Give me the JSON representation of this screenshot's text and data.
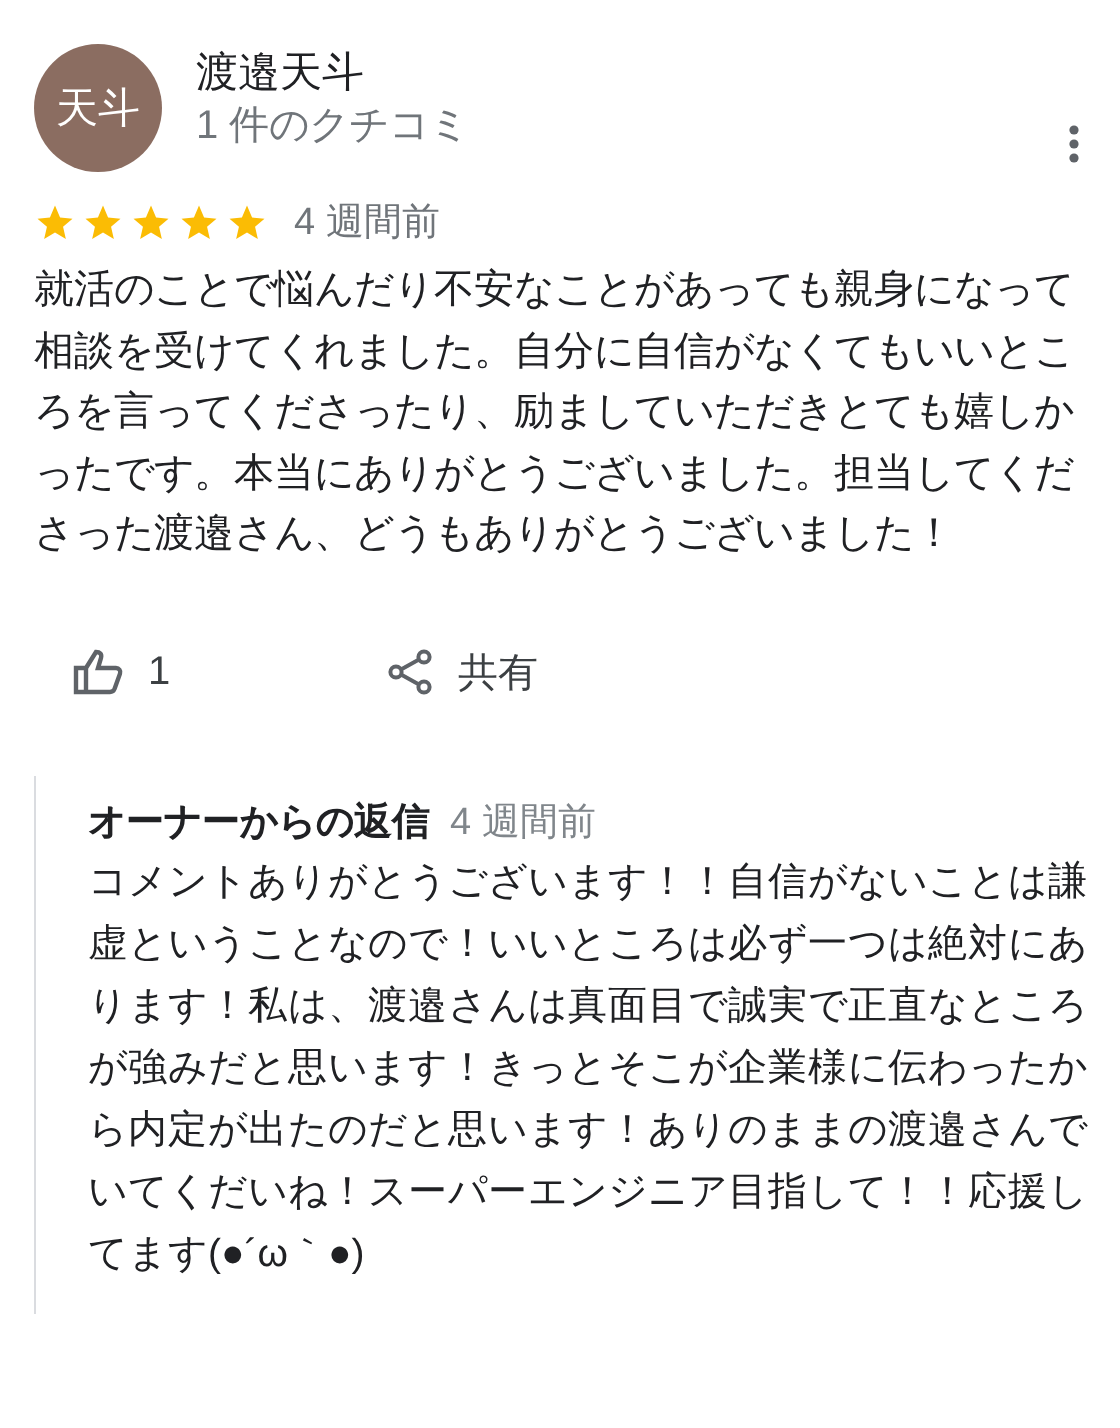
{
  "reviewer": {
    "avatar_text": "天斗",
    "name": "渡邉天斗",
    "review_count": "1 件のクチコミ"
  },
  "review": {
    "stars": 5,
    "time": "4 週間前",
    "text": "就活のことで悩んだり不安なことがあっても親身になって相談を受けてくれました。自分に自信がなくてもいいところを言ってくださったり、励ましていただきとても嬉しかったです。本当にありがとうございました。担当してくださった渡邉さん、どうもありがとうございました！"
  },
  "actions": [
    {
      "kind": "like",
      "label": "1"
    },
    {
      "kind": "share",
      "label": "共有"
    }
  ],
  "owner_reply": {
    "title": "オーナーからの返信",
    "time": "4 週間前",
    "text": "コメントありがとうございます！！自信がないことは謙虚ということなので！いいところは必ず一つは絶対にあります！私は、渡邉さんは真面目で誠実で正直なところが強みだと思います！きっとそこが企業様に伝わったから内定が出たのだと思います！ありのままの渡邉さんでいてくだいね！スーパーエンジニア目指して！！応援してます(●´ω｀●)"
  }
}
